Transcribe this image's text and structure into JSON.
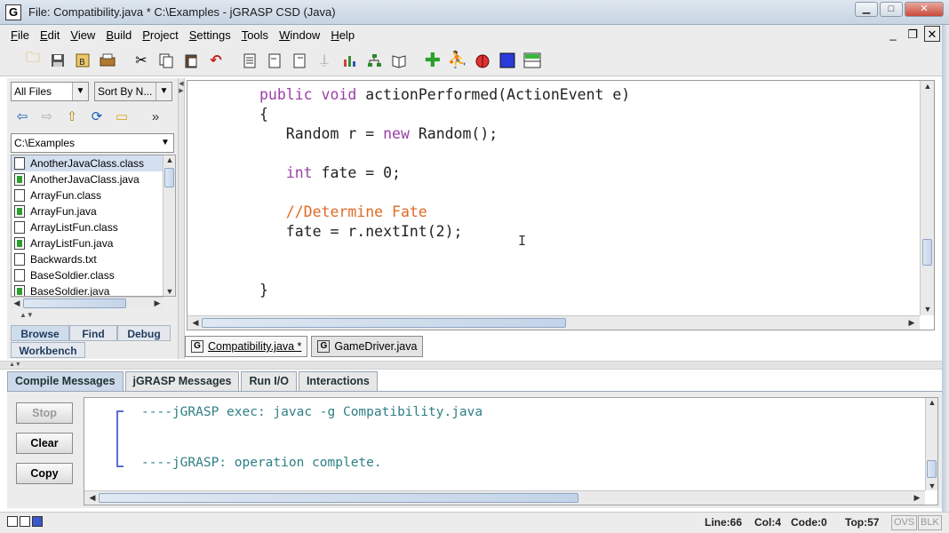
{
  "window": {
    "title": "File: Compatibility.java *  C:\\Examples - jGRASP CSD (Java)",
    "app_icon": "G",
    "controls": {
      "minimize": "▁",
      "maximize": "□",
      "close": "✕"
    }
  },
  "menubar": {
    "items": [
      "File",
      "Edit",
      "View",
      "Build",
      "Project",
      "Settings",
      "Tools",
      "Window",
      "Help"
    ]
  },
  "toolbar": {
    "icons": [
      "open-folder-icon",
      "save-icon",
      "save-all-icon",
      "print-icon",
      "cut-icon",
      "copy-icon",
      "paste-icon",
      "undo-icon",
      "format-icon",
      "document-icon",
      "document-alt-icon",
      "pin-icon",
      "bar-chart-icon",
      "tree-icon",
      "book-icon",
      "add-plus-icon",
      "debug-person-icon",
      "bug-icon",
      "blue-square-icon",
      "panel-icon"
    ]
  },
  "browse": {
    "filter_combo": "All Files",
    "sort_combo": "Sort By N...",
    "path": "C:\\Examples",
    "files": [
      {
        "name": "AnotherJavaClass.class",
        "type": "class",
        "selected": true
      },
      {
        "name": "AnotherJavaClass.java",
        "type": "java",
        "selected": false
      },
      {
        "name": "ArrayFun.class",
        "type": "class",
        "selected": false
      },
      {
        "name": "ArrayFun.java",
        "type": "java",
        "selected": false
      },
      {
        "name": "ArrayListFun.class",
        "type": "class",
        "selected": false
      },
      {
        "name": "ArrayListFun.java",
        "type": "java",
        "selected": false
      },
      {
        "name": "Backwards.txt",
        "type": "txt",
        "selected": false
      },
      {
        "name": "BaseSoldier.class",
        "type": "class",
        "selected": false
      },
      {
        "name": "BaseSoldier.java",
        "type": "java",
        "selected": false
      }
    ],
    "tabs": [
      "Browse",
      "Find",
      "Debug",
      "Workbench"
    ]
  },
  "editor": {
    "lines": [
      [
        {
          "t": "public void ",
          "k": "kw"
        },
        {
          "t": "actionPerformed(ActionEvent e)",
          "k": ""
        }
      ],
      [
        {
          "t": "{",
          "k": ""
        }
      ],
      [
        {
          "t": "   Random r = ",
          "k": ""
        },
        {
          "t": "new",
          "k": "kw"
        },
        {
          "t": " Random();",
          "k": ""
        }
      ],
      [],
      [
        {
          "t": "   ",
          "k": ""
        },
        {
          "t": "int",
          "k": "kw"
        },
        {
          "t": " fate = 0;",
          "k": ""
        }
      ],
      [],
      [
        {
          "t": "   //Determine Fate",
          "k": "cm"
        }
      ],
      [
        {
          "t": "   fate = r.nextInt(2);",
          "k": ""
        }
      ],
      [],
      [],
      [
        {
          "t": "}",
          "k": ""
        }
      ]
    ],
    "cursor": "I",
    "tabs": [
      {
        "label": "Compatibility.java *",
        "active": true
      },
      {
        "label": "GameDriver.java",
        "active": false
      }
    ]
  },
  "messages": {
    "tabs": [
      "Compile Messages",
      "jGRASP Messages",
      "Run I/O",
      "Interactions"
    ],
    "buttons": {
      "stop": "Stop",
      "clear": "Clear",
      "copy": "Copy"
    },
    "line1": "----jGRASP exec: javac -g Compatibility.java",
    "line2": "----jGRASP: operation complete."
  },
  "status": {
    "line": "Line:66",
    "col": "Col:4",
    "code": "Code:0",
    "top": "Top:57",
    "ovs": "OVS",
    "blk": "BLK"
  }
}
